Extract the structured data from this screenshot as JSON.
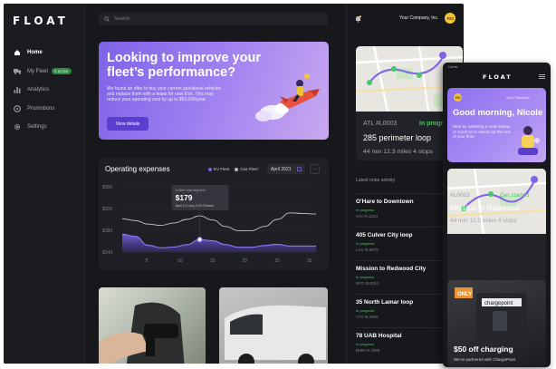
{
  "desktop": {
    "logo": "FLOAT",
    "nav": [
      {
        "label": "Home",
        "icon": "home-icon",
        "active": true
      },
      {
        "label": "My Fleet",
        "icon": "truck-icon",
        "badge": "5 active"
      },
      {
        "label": "Analytics",
        "icon": "bar-chart-icon"
      },
      {
        "label": "Promotions",
        "icon": "tag-icon"
      },
      {
        "label": "Settings",
        "icon": "gear-icon"
      }
    ],
    "search": {
      "placeholder": "Search"
    },
    "company": "Your Company, Inc.",
    "avatar_initials": "YCI",
    "promo": {
      "title": "Looking to improve your fleet’s performance?",
      "body": "We found an offer to buy your current gas/diesel vehicles and replace them with a lease for new EVs. This may reduce your operating cost by up to $50,000/year.",
      "button": "View details"
    },
    "operating": {
      "title": "Operating expenses",
      "legend": [
        "EV Fleet",
        "Gas Fleet"
      ],
      "month": "April 2021",
      "tooltip_sub": "In fleet cost segment",
      "tooltip_value": "$179",
      "tooltip_detail": "April 13 | Avg 3 EV Routes"
    },
    "chart_data": {
      "type": "area",
      "x": [
        1,
        3,
        5,
        7,
        9,
        11,
        13,
        15,
        17,
        19,
        21,
        23,
        25,
        27,
        29,
        31
      ],
      "xticks": [
        "5",
        "10",
        "15",
        "20",
        "25",
        "30"
      ],
      "yticks": [
        "$360",
        "$320",
        "$180",
        "$140"
      ],
      "series": [
        {
          "name": "EV Fleet",
          "values": [
            200,
            193,
            163,
            154,
            157,
            165,
            182,
            178,
            165,
            156,
            156,
            162,
            166,
            160,
            160,
            160
          ]
        },
        {
          "name": "Gas Fleet",
          "values": [
            252,
            246,
            234,
            230,
            238,
            250,
            262,
            248,
            226,
            212,
            212,
            226,
            250,
            272,
            270,
            268
          ]
        }
      ],
      "ylim": [
        140,
        360
      ],
      "grid": true
    },
    "map_card": {
      "route_id": "ATL #L0003",
      "status": "In progress",
      "name": "285 perimeter loop",
      "stats": "44 min  12.3 miles  4 stops"
    },
    "activity": {
      "heading": "Latest route activity",
      "items": [
        {
          "title": "O'Hare to Downtown",
          "status": "In progress",
          "code": "CHI #L1234"
        },
        {
          "title": "405 Culver City loop",
          "status": "In progress",
          "code": "LAX #L5678"
        },
        {
          "title": "Mission to Redwood City",
          "status": "In progress",
          "code": "SFO #L9012"
        },
        {
          "title": "35 North Lamar loop",
          "status": "In progress",
          "code": "ATX #L3456"
        },
        {
          "title": "78 UAB Hospital",
          "status": "In progress",
          "code": "BHM #L7890"
        }
      ]
    }
  },
  "mobile": {
    "status_bar": "Carrier",
    "logo": "FLOAT",
    "avatar_initials": "YCI",
    "city": "San Francisco",
    "greeting": "Good morning, Nicole",
    "body": "Start by selecting a route below, or scroll on to check out the rest of your fleet.",
    "route_id": "#L0003",
    "status": "Get started",
    "route_name": "Mission to Redwood",
    "stats": "44 min  12.3 miles  4 stops",
    "charge_title": "$50 off charging",
    "charge_sub": "We've partnered with ChargePoint",
    "charge_sign": "chargepoint",
    "charge_label": "ONLY"
  },
  "colors": {
    "accent": "#7f63e8",
    "success": "#48c766",
    "avatar": "#f7c531"
  }
}
